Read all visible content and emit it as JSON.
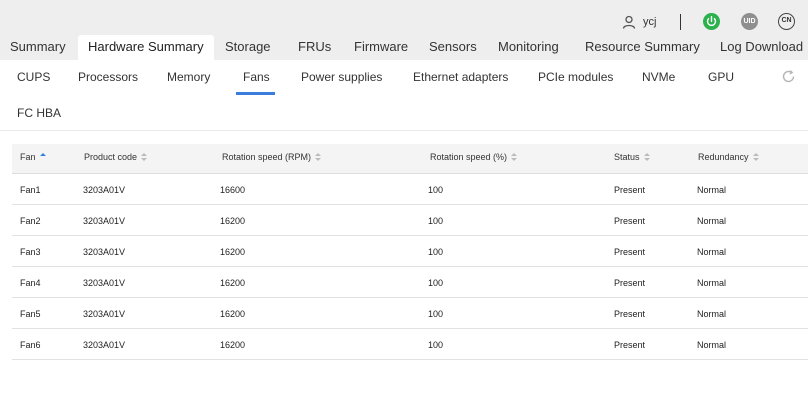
{
  "header": {
    "username": "ycj",
    "uid_label": "UID",
    "lang_label": "CN",
    "tabs": [
      {
        "label": "Summary"
      },
      {
        "label": "Hardware Summary"
      },
      {
        "label": "Storage"
      },
      {
        "label": "FRUs"
      },
      {
        "label": "Firmware"
      },
      {
        "label": "Sensors"
      },
      {
        "label": "Monitoring"
      },
      {
        "label": "Resource Summary"
      },
      {
        "label": "Log Download"
      }
    ],
    "active_tab": "Hardware Summary"
  },
  "subtabs": {
    "items": [
      {
        "label": "CUPS"
      },
      {
        "label": "Processors"
      },
      {
        "label": "Memory"
      },
      {
        "label": "Fans"
      },
      {
        "label": "Power supplies"
      },
      {
        "label": "Ethernet adapters"
      },
      {
        "label": "PCIe modules"
      },
      {
        "label": "NVMe"
      },
      {
        "label": "GPU"
      },
      {
        "label": "FC HBA"
      }
    ],
    "active": "Fans"
  },
  "table": {
    "columns": [
      "Fan",
      "Product code",
      "Rotation speed (RPM)",
      "Rotation speed (%)",
      "Status",
      "Redundancy"
    ],
    "sorted_column": "Fan",
    "rows": [
      [
        "Fan1",
        "3203A01V",
        "16600",
        "100",
        "Present",
        "Normal"
      ],
      [
        "Fan2",
        "3203A01V",
        "16200",
        "100",
        "Present",
        "Normal"
      ],
      [
        "Fan3",
        "3203A01V",
        "16200",
        "100",
        "Present",
        "Normal"
      ],
      [
        "Fan4",
        "3203A01V",
        "16200",
        "100",
        "Present",
        "Normal"
      ],
      [
        "Fan5",
        "3203A01V",
        "16200",
        "100",
        "Present",
        "Normal"
      ],
      [
        "Fan6",
        "3203A01V",
        "16200",
        "100",
        "Present",
        "Normal"
      ]
    ]
  },
  "colors": {
    "accent": "#3b7ddd",
    "power": "#2bb24c",
    "topbar_bg": "#eeeeee"
  }
}
